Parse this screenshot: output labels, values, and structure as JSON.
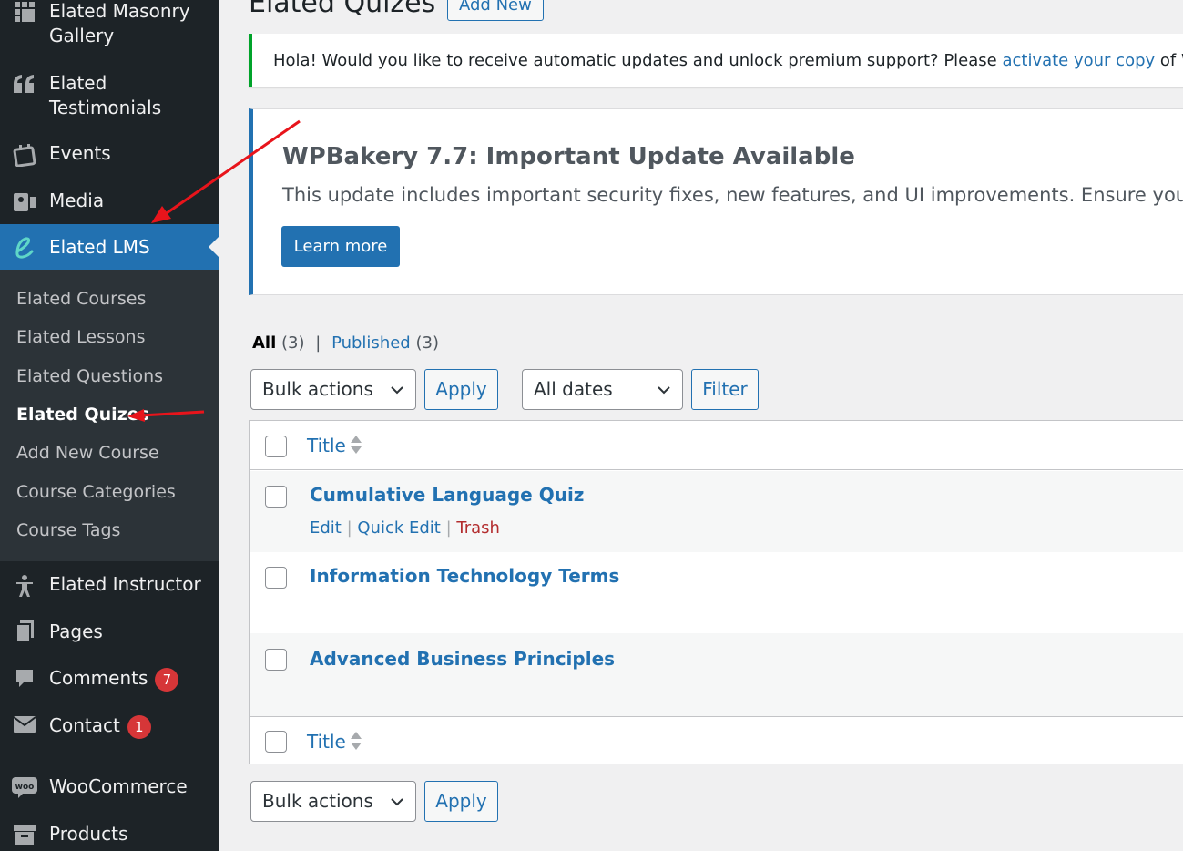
{
  "sidebar": {
    "items": [
      {
        "label": "Elated Masonry Gallery",
        "icon": "grid-icon"
      },
      {
        "label": "Elated Testimonials",
        "icon": "quote-icon"
      },
      {
        "label": "Events",
        "icon": "calendar-icon"
      },
      {
        "label": "Media",
        "icon": "media-icon"
      },
      {
        "label": "Elated LMS",
        "icon": "elated-e-icon"
      },
      {
        "label": "Elated Instructor",
        "icon": "person-icon"
      },
      {
        "label": "Pages",
        "icon": "pages-icon"
      },
      {
        "label": "Comments",
        "icon": "comment-icon",
        "badge": "7"
      },
      {
        "label": "Contact",
        "icon": "mail-icon",
        "badge": "1"
      },
      {
        "label": "WooCommerce",
        "icon": "woo-icon"
      },
      {
        "label": "Products",
        "icon": "archive-icon"
      }
    ],
    "masonry_line1": "Elated Masonry",
    "masonry_line2": "Gallery",
    "testimonials_line1": "Elated",
    "testimonials_line2": "Testimonials",
    "submenu": [
      {
        "label": "Elated Courses"
      },
      {
        "label": "Elated Lessons"
      },
      {
        "label": "Elated Questions"
      },
      {
        "label": "Elated Quizes",
        "current": true
      },
      {
        "label": "Add New Course"
      },
      {
        "label": "Course Categories"
      },
      {
        "label": "Course Tags"
      }
    ]
  },
  "header": {
    "title": "Elated Quizes",
    "add_new": "Add New"
  },
  "notices": {
    "update_prefix": "Hola! Would you like to receive automatic updates and unlock premium support? Please ",
    "update_link": "activate your copy",
    "update_suffix": " of WPBa",
    "wpb_title": "WPBakery 7.7: Important Update Available",
    "wpb_text": "This update includes important security fixes, new features, and UI improvements. Ensure your",
    "wpb_button": "Learn more"
  },
  "filters": {
    "all_label": "All",
    "all_count": "(3)",
    "separator": "|",
    "published_label": "Published",
    "published_count": "(3)",
    "bulk_actions": "Bulk actions",
    "apply": "Apply",
    "all_dates": "All dates",
    "filter": "Filter"
  },
  "table": {
    "column_title": "Title",
    "rows": [
      {
        "title": "Cumulative Language Quiz",
        "actions": [
          "Edit",
          "Quick Edit",
          "Trash"
        ]
      },
      {
        "title": "Information Technology Terms"
      },
      {
        "title": "Advanced Business Principles"
      }
    ]
  },
  "colors": {
    "sidebar_bg": "#1d2327",
    "submenu_bg": "#2c3338",
    "accent": "#2271b1",
    "badge": "#d63638",
    "notice_green": "#00a32a",
    "arrow": "#e8141b"
  }
}
